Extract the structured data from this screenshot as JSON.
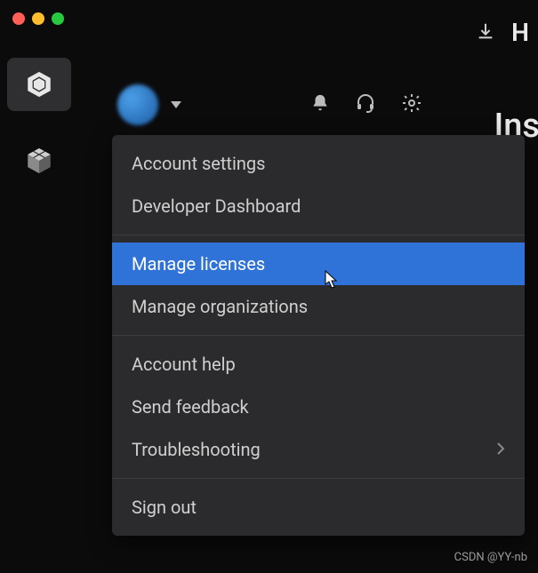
{
  "header": {
    "top_right_letter": "H",
    "big_text_partial": "Ins"
  },
  "menu": {
    "sections": [
      {
        "items": [
          {
            "label": "Account settings",
            "has_chevron": false
          },
          {
            "label": "Developer Dashboard",
            "has_chevron": false
          }
        ]
      },
      {
        "items": [
          {
            "label": "Manage licenses",
            "has_chevron": false,
            "selected": true
          },
          {
            "label": "Manage organizations",
            "has_chevron": false
          }
        ]
      },
      {
        "items": [
          {
            "label": "Account help",
            "has_chevron": false
          },
          {
            "label": "Send feedback",
            "has_chevron": false
          },
          {
            "label": "Troubleshooting",
            "has_chevron": true
          }
        ]
      },
      {
        "items": [
          {
            "label": "Sign out",
            "has_chevron": false
          }
        ]
      }
    ]
  },
  "watermark": "CSDN @YY-nb"
}
